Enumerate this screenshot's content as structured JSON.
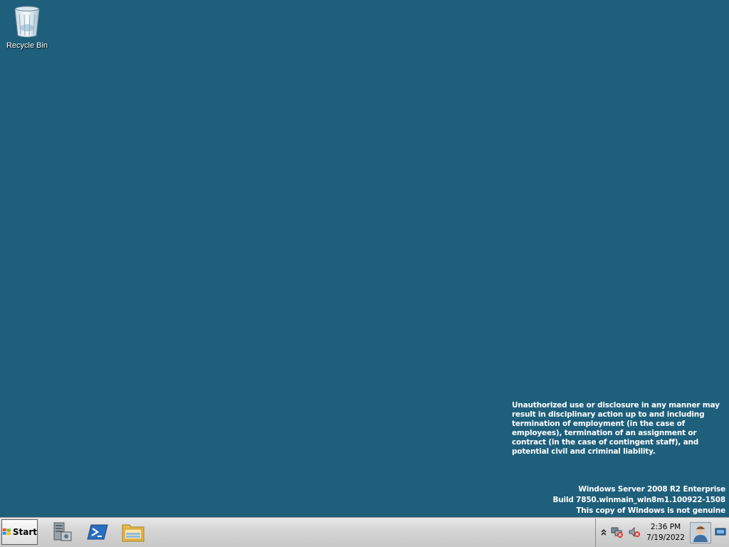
{
  "desktop": {
    "background_color": "#1e5f7b",
    "icons": [
      {
        "label": "Recycle Bin",
        "icon": "recycle-bin-icon"
      }
    ],
    "legal_notice": "Unauthorized use or disclosure in any manner may result in disciplinary action up to and including termination of employment (in the case of employees), termination of an assignment or contract (in the case of contingent staff), and potential civil and criminal liability.",
    "watermark": {
      "line1": "Windows Server 2008 R2 Enterprise",
      "line2": "Build 7850.winmain_win8m1.100922-1508",
      "line3": "This copy of Windows is not genuine"
    }
  },
  "taskbar": {
    "start_label": "Start",
    "pinned": [
      {
        "name": "server-manager",
        "icon": "server-manager-icon"
      },
      {
        "name": "powershell",
        "icon": "powershell-icon"
      },
      {
        "name": "windows-explorer",
        "icon": "folder-icon"
      }
    ],
    "tray": {
      "icons": [
        "show-hidden-icons-chevron",
        "network-error-icon",
        "volume-muted-icon"
      ],
      "time": "2:36 PM",
      "date": "7/19/2022",
      "user_icon": "user-avatar-icon",
      "show_desktop_icon": "show-desktop-icon"
    }
  }
}
